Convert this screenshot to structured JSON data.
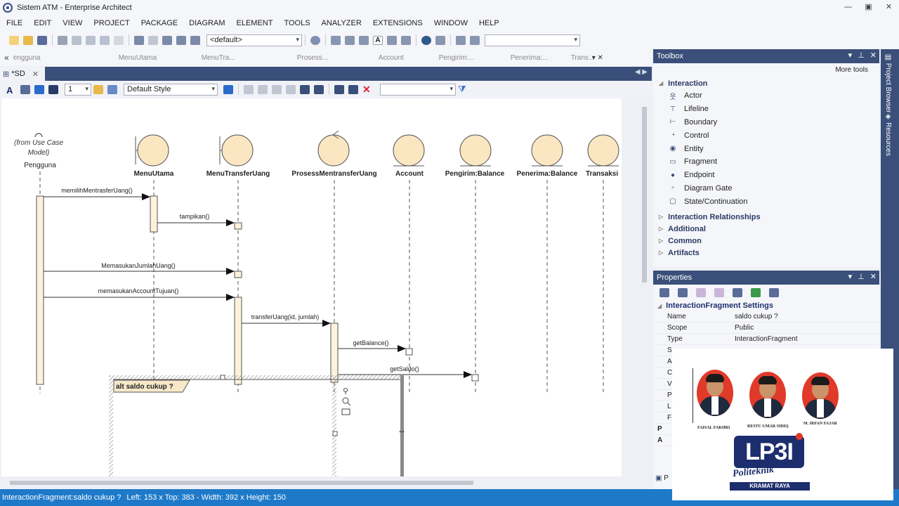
{
  "window": {
    "title": "Sistem ATM - Enterprise Architect",
    "controls": [
      "—",
      "▣",
      "✕"
    ]
  },
  "menu": [
    "FILE",
    "EDIT",
    "VIEW",
    "PROJECT",
    "PACKAGE",
    "DIAGRAM",
    "ELEMENT",
    "TOOLS",
    "ANALYZER",
    "EXTENSIONS",
    "WINDOW",
    "HELP"
  ],
  "toolbar": {
    "style_combo": "<default>",
    "search_combo": ""
  },
  "header_strip": [
    "engguna",
    "MenuUtama",
    "MenuTra...",
    "Prosess...",
    "Account",
    "Pengirim:...",
    "Penerima:...",
    "Trans..."
  ],
  "doc_tab": {
    "label": "*SD",
    "close": "✕"
  },
  "toolbar2": {
    "zoom": "1",
    "style": "Default Style",
    "filter_value": ""
  },
  "diagram": {
    "actor_note": "(from Use Case\nModel)",
    "actor_name": "Pengguna",
    "lifelines": [
      "MenuUtama",
      "MenuTransferUang",
      "ProsessMentransferUang",
      "Account",
      "Pengirim:Balance",
      "Penerima:Balance",
      "Transaksi"
    ],
    "messages": [
      "memilihMentrasferUang()",
      "tampikan()",
      "MemasukanJumlahUang()",
      "memasukanAccountTujuan()",
      "transferUang(id, jumlah)",
      "getBalance()",
      "getSaldo()"
    ],
    "fragment_label": "alt saldo cukup ?"
  },
  "toolbox": {
    "title": "Toolbox",
    "more_tools": "More tools",
    "section": "Interaction",
    "items": [
      {
        "label": "Actor",
        "icon": "actor-icon"
      },
      {
        "label": "Lifeline",
        "icon": "lifeline-icon"
      },
      {
        "label": "Boundary",
        "icon": "boundary-icon"
      },
      {
        "label": "Control",
        "icon": "control-icon"
      },
      {
        "label": "Entity",
        "icon": "entity-icon"
      },
      {
        "label": "Fragment",
        "icon": "fragment-icon"
      },
      {
        "label": "Endpoint",
        "icon": "endpoint-icon"
      },
      {
        "label": "Diagram Gate",
        "icon": "diagram-gate-icon"
      },
      {
        "label": "State/Continuation",
        "icon": "state-icon"
      }
    ],
    "collapsed": [
      "Interaction Relationships",
      "Additional",
      "Common",
      "Artifacts"
    ]
  },
  "properties": {
    "title": "Properties",
    "group": "InteractionFragment  Settings",
    "rows": [
      {
        "k": "Name",
        "v": "saldo cukup ?"
      },
      {
        "k": "Scope",
        "v": "Public"
      },
      {
        "k": "Type",
        "v": "InteractionFragment"
      }
    ],
    "truncated_keys": [
      "S",
      "A",
      "C",
      "V",
      "P",
      "L",
      "F",
      "P",
      "A"
    ],
    "bottom_tab": "P"
  },
  "sidebar": {
    "project_browser": "Project Browser",
    "resources": "Resources"
  },
  "status": {
    "element": "InteractionFragment:saldo cukup ?",
    "left": "Left:   153 x Top:   383 - Width:   392 x Height:   150"
  },
  "overlay": {
    "names": [
      "FAISAL FAKHRI",
      "RESTU UMAR SIDIQ",
      "M. IRFAN FAJAR"
    ],
    "logo": "LP3I",
    "logo_sub": "Politeknik",
    "logo_band": "KRAMAT RAYA"
  },
  "colors": {
    "accent": "#3a4f7a",
    "status": "#1e7ac9",
    "lifeline_fill": "#fdf2dc",
    "fragment_label_bg": "#f6e8c9",
    "brand_blue": "#1d2e6e",
    "brand_red": "#e03a2a"
  }
}
